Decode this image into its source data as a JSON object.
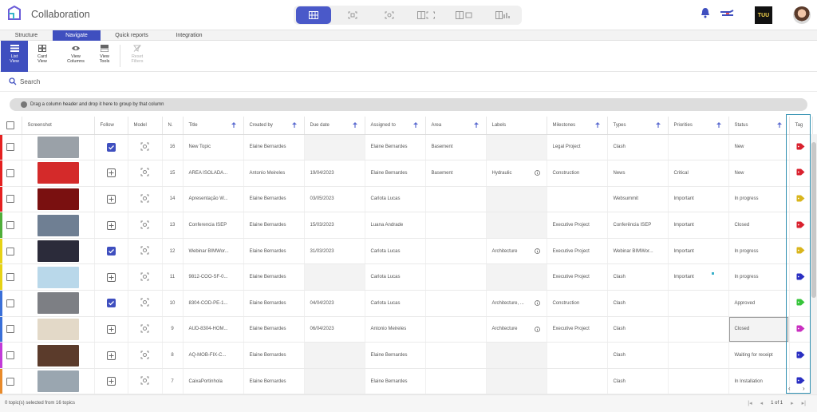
{
  "app": {
    "title": "Collaboration",
    "badge": "TUU"
  },
  "tabs": [
    {
      "label": "Structure",
      "active": false
    },
    {
      "label": "Navigate",
      "active": true
    },
    {
      "label": "Quick reports",
      "active": false
    },
    {
      "label": "Integration",
      "active": false
    }
  ],
  "ribbon": {
    "list_view": "List View",
    "card_view": "Card View",
    "view_columns": "View Columns",
    "view_tools": "View Tools",
    "reset_filters": "Reset Filters"
  },
  "search": {
    "placeholder": "Search"
  },
  "groupbar": {
    "text": "Drag a column header and drop it here to group by that column"
  },
  "columns": [
    "Screenshot",
    "Follow",
    "Model",
    "N.",
    "Title",
    "Created by",
    "Due date",
    "Assigned to",
    "Area",
    "Labels",
    "Milestones",
    "Types",
    "Priorities",
    "Status",
    "Tag"
  ],
  "rows": [
    {
      "bar": "#e52020",
      "thumb": "#9aa1a8",
      "follow": true,
      "n": "16",
      "title": "New Topic",
      "created_by": "Elaine Bernardes",
      "due": "",
      "assigned": "Elaine Bernardes",
      "area": "Basement",
      "labels": "",
      "milestone": "Legal Project",
      "type": "Clash",
      "priority": "",
      "status": "New",
      "tag": "#d9212e"
    },
    {
      "bar": "#e52020",
      "thumb": "#d42a2a",
      "follow": false,
      "n": "15",
      "title": "AREA ISOLADA...",
      "created_by": "Antonio Meireles",
      "due": "19/04/2023",
      "assigned": "Elaine Bernardes",
      "area": "Basement",
      "labels": "Hydraulic",
      "milestone": "Construction",
      "type": "News",
      "priority": "Critical",
      "status": "New",
      "tag": "#d9212e"
    },
    {
      "bar": "#e52020",
      "thumb": "#7a1010",
      "follow": false,
      "n": "14",
      "title": "Apresentação W...",
      "created_by": "Elaine Bernardes",
      "due": "03/05/2023",
      "assigned": "Carlota Lucas",
      "area": "",
      "labels": "",
      "milestone": "",
      "type": "Websummit",
      "priority": "Important",
      "status": "In progress",
      "tag": "#d9b51c"
    },
    {
      "bar": "#4fae3a",
      "thumb": "#6f7f93",
      "follow": false,
      "n": "13",
      "title": "Conferencia ISEP",
      "created_by": "Elaine Bernardes",
      "due": "15/03/2023",
      "assigned": "Luana Andrade",
      "area": "",
      "labels": "",
      "milestone": "Executive Project",
      "type": "Conferência ISEP",
      "priority": "Important",
      "status": "Closed",
      "tag": "#d9212e"
    },
    {
      "bar": "#e6d215",
      "thumb": "#2b2b3a",
      "follow": true,
      "n": "12",
      "title": "Webinar BIMWor...",
      "created_by": "Elaine Bernardes",
      "due": "31/03/2023",
      "assigned": "Carlota Lucas",
      "area": "",
      "labels": "Architecture",
      "milestone": "Executive Project",
      "type": "Webinar BIMWor...",
      "priority": "Important",
      "status": "In progress",
      "tag": "#d9b51c"
    },
    {
      "bar": "#e6d215",
      "thumb": "#b9d8ea",
      "follow": false,
      "n": "11",
      "title": "9812-COO-SF-0...",
      "created_by": "Elaine Bernardes",
      "due": "",
      "assigned": "Carlota Lucas",
      "area": "",
      "labels": "",
      "milestone": "Executive Project",
      "type": "Clash",
      "priority": "Important",
      "status": "In progress",
      "tag": "#2a2fc2"
    },
    {
      "bar": "#3a6fd8",
      "thumb": "#7d7f84",
      "follow": true,
      "n": "10",
      "title": "8304-COD-PE-1...",
      "created_by": "Elaine Bernardes",
      "due": "04/04/2023",
      "assigned": "Carlota Lucas",
      "area": "",
      "labels": "Architecture, ...",
      "milestone": "Construction",
      "type": "Clash",
      "priority": "",
      "status": "Approved",
      "tag": "#36c43a"
    },
    {
      "bar": "#3a6fd8",
      "thumb": "#e3d9c8",
      "follow": false,
      "n": "9",
      "title": "AUD-8304-HOM...",
      "created_by": "Elaine Bernardes",
      "due": "06/04/2023",
      "assigned": "Antonio Meireles",
      "area": "",
      "labels": "Architecture",
      "milestone": "Executive Project",
      "type": "Clash",
      "priority": "",
      "status": "Closed",
      "tag": "#c92fc0"
    },
    {
      "bar": "#c23ad8",
      "thumb": "#5b3b2b",
      "follow": false,
      "n": "8",
      "title": "AQ-MOB-FIX-C...",
      "created_by": "Elaine Bernardes",
      "due": "",
      "assigned": "Elaine Bernardes",
      "area": "",
      "labels": "",
      "milestone": "",
      "type": "Clash",
      "priority": "",
      "status": "Waiting for receipt",
      "tag": "#2a2fc2"
    },
    {
      "bar": "#e88a2a",
      "thumb": "#9aa6b0",
      "follow": false,
      "n": "7",
      "title": "CaixaPortinhola",
      "created_by": "Elaine Bernardes",
      "due": "",
      "assigned": "Elaine Bernardes",
      "area": "",
      "labels": "",
      "milestone": "",
      "type": "Clash",
      "priority": "",
      "status": "In Installation",
      "tag": "#2a2fc2"
    }
  ],
  "footer": {
    "selection": "0 topic(s) selected from 16 topics",
    "page_info": "1 of 1"
  },
  "colors": {
    "accent": "#3f4fbf",
    "highlight": "#2f8fb0"
  }
}
